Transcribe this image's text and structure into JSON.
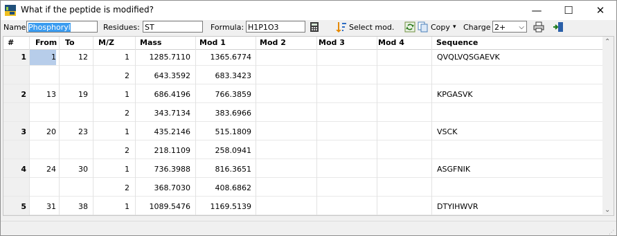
{
  "window": {
    "title": "What if the peptide is modified?"
  },
  "controls": {
    "minimize": "—",
    "maximize": "☐",
    "close": "✕"
  },
  "toolbar": {
    "name_label": "Name:",
    "name_value": "Phosphoryl",
    "residues_label": "Residues:",
    "residues_value": "ST",
    "formula_label": "Formula:",
    "formula_value": "H1P1O3",
    "select_mod_label": "Select mod.",
    "copy_label": "Copy",
    "charge_label": "Charge",
    "charge_value": "2+"
  },
  "table": {
    "headers": [
      "#",
      "From",
      "To",
      "M/Z",
      "Mass",
      "Mod 1",
      "Mod 2",
      "Mod 3",
      "Mod 4",
      "Sequence"
    ],
    "rows": [
      {
        "num": "1",
        "from": "1",
        "to": "12",
        "mz": "1",
        "mass": "1285.7110",
        "mod1": "1365.6774",
        "seq": "QVQLVQSGAEVK"
      },
      {
        "num": "",
        "from": "",
        "to": "",
        "mz": "2",
        "mass": "643.3592",
        "mod1": "683.3423",
        "seq": ""
      },
      {
        "num": "2",
        "from": "13",
        "to": "19",
        "mz": "1",
        "mass": "686.4196",
        "mod1": "766.3859",
        "seq": "KPGASVK"
      },
      {
        "num": "",
        "from": "",
        "to": "",
        "mz": "2",
        "mass": "343.7134",
        "mod1": "383.6966",
        "seq": ""
      },
      {
        "num": "3",
        "from": "20",
        "to": "23",
        "mz": "1",
        "mass": "435.2146",
        "mod1": "515.1809",
        "seq": "VSCK"
      },
      {
        "num": "",
        "from": "",
        "to": "",
        "mz": "2",
        "mass": "218.1109",
        "mod1": "258.0941",
        "seq": ""
      },
      {
        "num": "4",
        "from": "24",
        "to": "30",
        "mz": "1",
        "mass": "736.3988",
        "mod1": "816.3651",
        "seq": "ASGFNIK"
      },
      {
        "num": "",
        "from": "",
        "to": "",
        "mz": "2",
        "mass": "368.7030",
        "mod1": "408.6862",
        "seq": ""
      },
      {
        "num": "5",
        "from": "31",
        "to": "38",
        "mz": "1",
        "mass": "1089.5476",
        "mod1": "1169.5139",
        "seq": "DTYIHWVR"
      }
    ]
  }
}
